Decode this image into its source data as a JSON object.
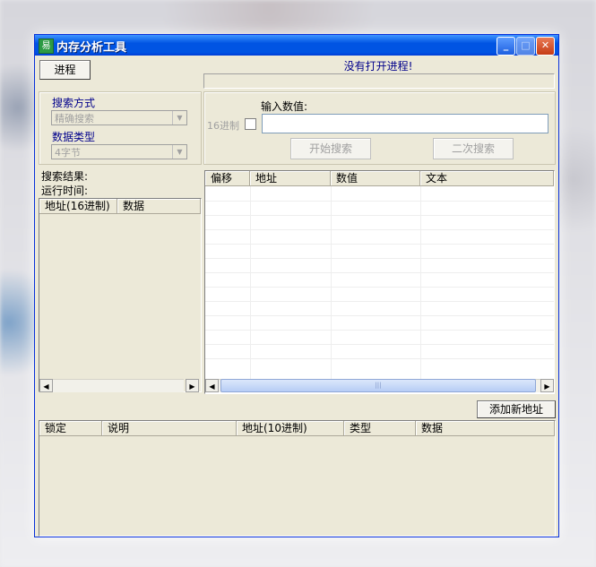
{
  "window": {
    "title": "内存分析工具",
    "controls": {
      "minimize": "_",
      "maximize": "□",
      "close": "✕"
    }
  },
  "toolbar": {
    "process_button": "进程",
    "status_text": "没有打开进程!"
  },
  "search_options": {
    "method_label": "搜索方式",
    "method_value": "精确搜索",
    "datatype_label": "数据类型",
    "datatype_value": "4字节"
  },
  "search_input": {
    "label": "输入数值:",
    "hex_label": "16进制",
    "value": "",
    "start_button": "开始搜索",
    "second_button": "二次搜索"
  },
  "results_info": {
    "results_label": "搜索结果:",
    "runtime_label": "运行时间:"
  },
  "results_list": {
    "columns": [
      "地址(16进制)",
      "数据"
    ]
  },
  "memory_view": {
    "columns": [
      "偏移",
      "地址",
      "数值",
      "文本"
    ],
    "scroll_grip": "|||"
  },
  "address_panel": {
    "add_button": "添加新地址",
    "columns": [
      "锁定",
      "说明",
      "地址(10进制)",
      "类型",
      "数据"
    ]
  },
  "icons": {
    "app": "app-icon",
    "dropdown": "chevron-down-icon",
    "scroll_left": "arrow-left-icon",
    "scroll_right": "arrow-right-icon"
  }
}
